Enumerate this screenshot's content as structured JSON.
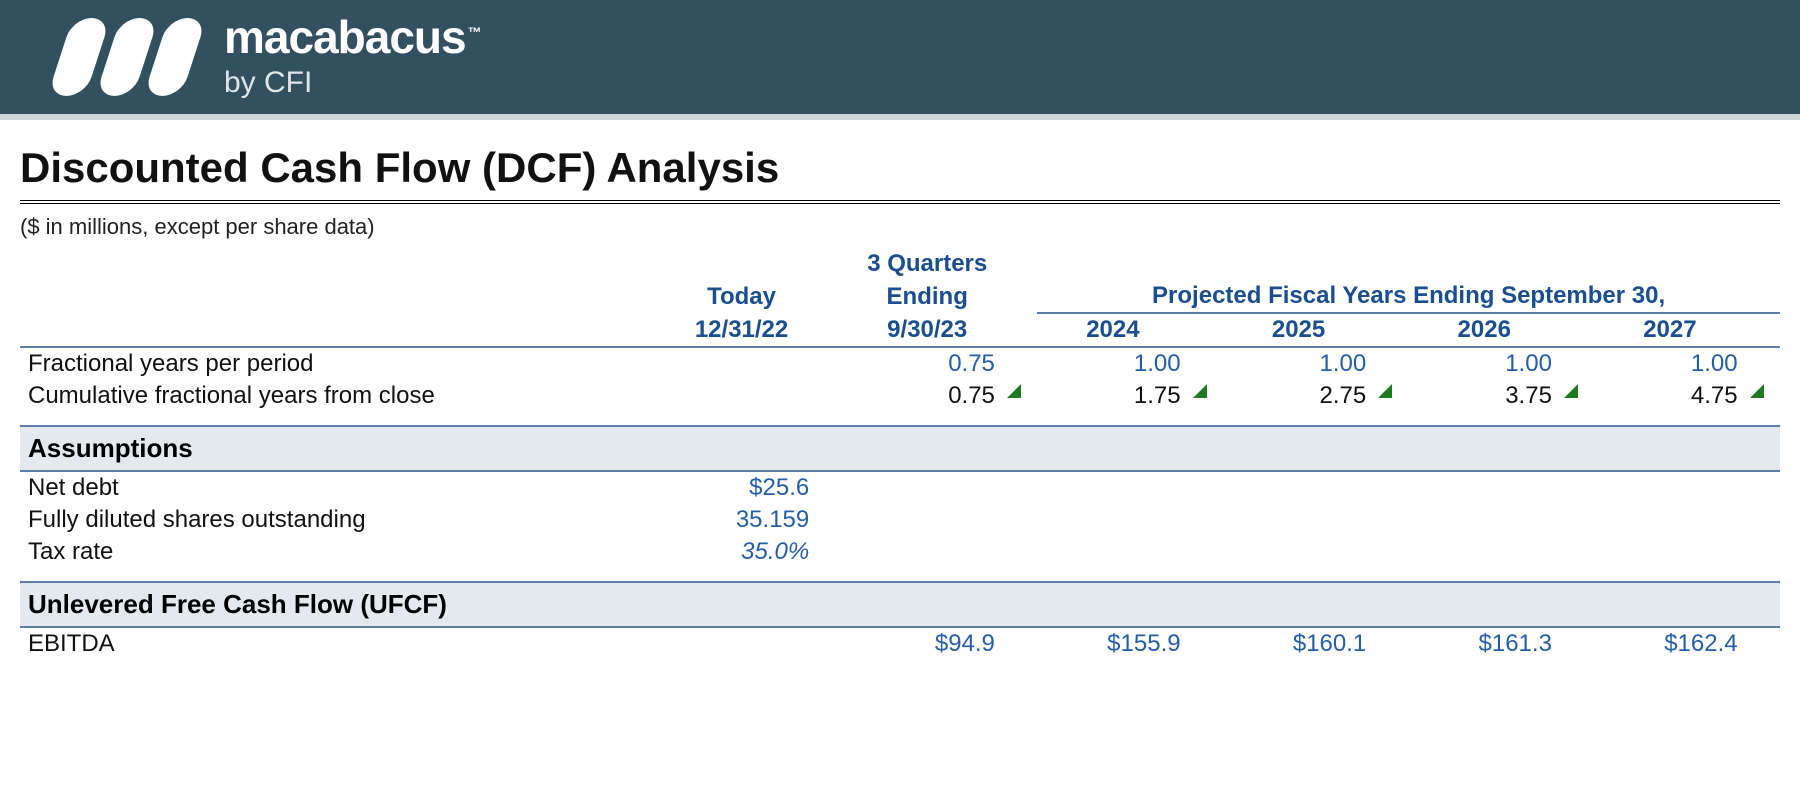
{
  "brand": {
    "name": "macabacus",
    "tm": "™",
    "byline": "by CFI"
  },
  "title": "Discounted Cash Flow (DCF) Analysis",
  "unit_note": "($ in millions, except per share data)",
  "headers": {
    "today_label": "Today",
    "today_date": "12/31/22",
    "stub_label_top": "3 Quarters",
    "stub_label_bottom": "Ending",
    "stub_date": "9/30/23",
    "proj_label": "Projected Fiscal Years Ending September 30,",
    "years": [
      "2024",
      "2025",
      "2026",
      "2027"
    ]
  },
  "rows": {
    "frac_label": "Fractional years per period",
    "frac_vals": {
      "stub": "0.75",
      "y": [
        "1.00",
        "1.00",
        "1.00",
        "1.00"
      ]
    },
    "cum_label": "Cumulative fractional years from close",
    "cum_vals": {
      "stub": "0.75",
      "y": [
        "1.75",
        "2.75",
        "3.75",
        "4.75"
      ]
    }
  },
  "sections": {
    "assumptions": "Assumptions",
    "ufcf": "Unlevered Free Cash Flow (UFCF)"
  },
  "assumptions": {
    "net_debt_label": "Net debt",
    "net_debt_val": "$25.6",
    "fdso_label": "Fully diluted shares outstanding",
    "fdso_val": "35.159",
    "tax_label": "Tax rate",
    "tax_val": "35.0%"
  },
  "ufcf": {
    "ebitda_label": "EBITDA",
    "ebitda_vals": {
      "stub": "$94.9",
      "y": [
        "$155.9",
        "$160.1",
        "$161.3",
        "$162.4"
      ]
    }
  }
}
